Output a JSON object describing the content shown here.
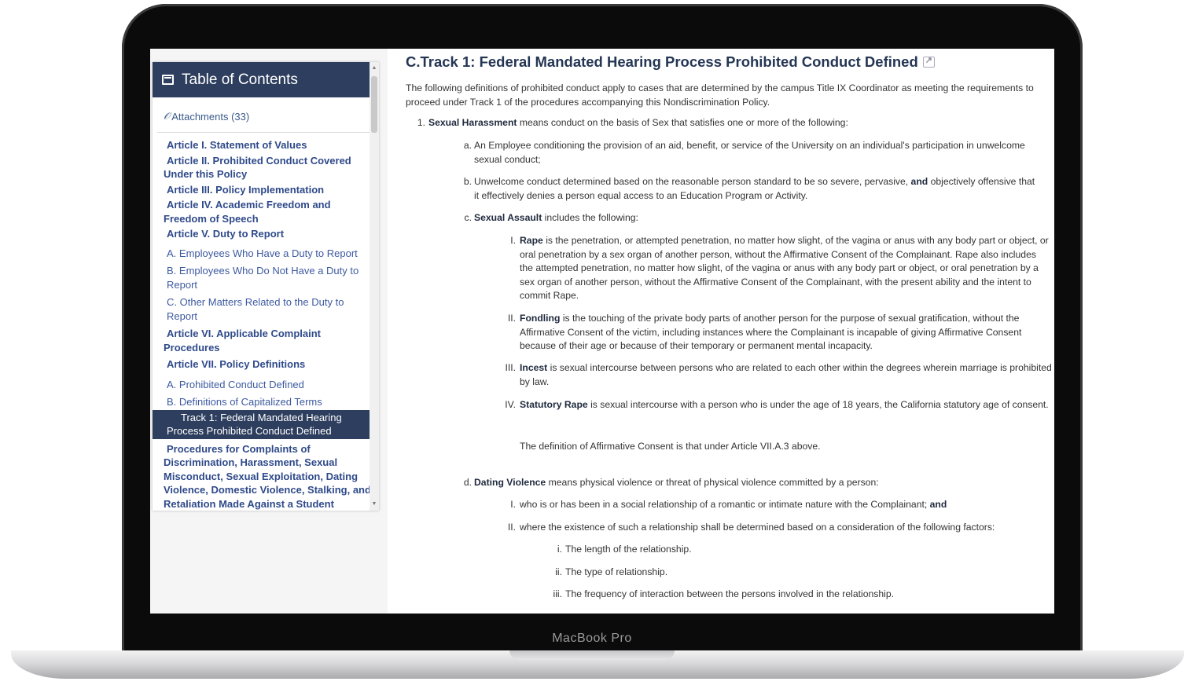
{
  "device": {
    "label": "MacBook Pro"
  },
  "sidebar": {
    "header": "Table of Contents",
    "attachments": "Attachments (33)",
    "items": [
      {
        "label": "Article I. Statement of Values"
      },
      {
        "label": "Article II. Prohibited Conduct Covered Under this Policy"
      },
      {
        "label": "Article III. Policy Implementation"
      },
      {
        "label": "Article IV. Academic Freedom and Freedom of Speech"
      },
      {
        "label": "Article V. Duty to Report"
      },
      {
        "label": "A. Employees Who Have a Duty to Report"
      },
      {
        "label": "B. Employees Who Do Not Have a Duty to Report"
      },
      {
        "label": "C. Other Matters Related to the Duty to Report"
      },
      {
        "label": "Article VI. Applicable Complaint Procedures"
      },
      {
        "label": "Article VII. Policy Definitions"
      },
      {
        "label": "A. Prohibited Conduct Defined"
      },
      {
        "label": "B. Definitions of Capitalized Terms"
      },
      {
        "label": "Track 1: Federal Mandated Hearing Process Prohibited Conduct Defined"
      },
      {
        "label": "Procedures for Complaints of Discrimination, Harassment, Sexual Misconduct, Sexual Exploitation, Dating Violence, Domestic Violence, Stalking, and Retaliation Made Against a Student"
      }
    ]
  },
  "main": {
    "title": "C.Track 1: Federal Mandated Hearing Process Prohibited Conduct Defined",
    "intro": "The following definitions of prohibited conduct apply to cases that are determined by the campus Title IX Coordinator as meeting the requirements to proceed under Track 1 of the procedures accompanying this Nondiscrimination Policy.",
    "item1": {
      "marker": "1.",
      "term": "Sexual Harassment",
      "text": " means conduct on the basis of Sex that satisfies one or more of the following:"
    },
    "a": {
      "marker": "a.",
      "text": "An Employee conditioning the provision of an aid, benefit, or service of the University on an individual's participation in unwelcome sexual conduct;"
    },
    "b": {
      "marker": "b.",
      "text1": "Unwelcome conduct determined based on the reasonable person standard to be so severe, pervasive, ",
      "and": "and",
      "text2": " objectively offensive that it effectively denies a person equal access to an Education Program or Activity."
    },
    "c": {
      "marker": "c.",
      "term": "Sexual Assault",
      "text": " includes the following:"
    },
    "cI": {
      "marker": "I.",
      "term": "Rape",
      "text": " is the penetration, or attempted penetration, no matter how slight, of the vagina or anus with any body part or object, or oral penetration by a sex organ of another person, without the Affirmative Consent of the Complainant. Rape also includes the attempted penetration, no matter how slight, of the vagina or anus with any body part or object, or oral penetration by a sex organ of another person, without the Affirmative Consent of the Complainant, with the present ability and the intent to commit Rape."
    },
    "cII": {
      "marker": "II.",
      "term": "Fondling",
      "text": " is the touching of the private body parts of another person for the purpose of sexual gratification, without the Affirmative Consent of the victim, including instances where the Complainant is incapable of giving Affirmative Consent because of their age or because of their temporary or permanent mental incapacity."
    },
    "cIII": {
      "marker": "III.",
      "term": "Incest",
      "text": " is sexual intercourse between persons who are related to each other within the degrees wherein marriage is prohibited by law."
    },
    "cIV": {
      "marker": "IV.",
      "term": "Statutory Rape",
      "text": " is sexual intercourse with a person who is under the age of 18 years, the California statutory age of consent."
    },
    "consent_note": "The definition of Affirmative Consent is that under Article VII.A.3 above.",
    "d": {
      "marker": "d.",
      "term": "Dating Violence",
      "text": " means physical violence or threat of physical violence committed by a person:"
    },
    "dI": {
      "marker": "I.",
      "text": "who is or has been in a social relationship of a romantic or intimate nature with the Complainant; ",
      "and": "and"
    },
    "dII": {
      "marker": "II.",
      "text": "where the existence of such a relationship shall be determined based on a consideration of the following factors:"
    },
    "di": {
      "marker": "i.",
      "text": "The length of the relationship."
    },
    "dii": {
      "marker": "ii.",
      "text": "The type of relationship."
    },
    "diii": {
      "marker": "iii.",
      "text": "The frequency of interaction between the persons involved in the relationship."
    }
  }
}
